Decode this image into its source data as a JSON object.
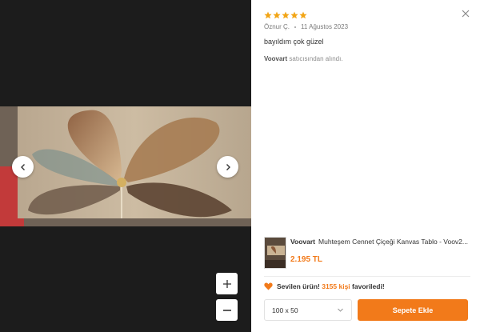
{
  "review": {
    "rating": 5,
    "author": "Öznur Ç.",
    "date": "11 Ağustos 2023",
    "comment": "bayıldım çok güzel",
    "seller_name": "Voovart",
    "seller_suffix": " satıcısından alındı."
  },
  "product": {
    "brand": "Voovart",
    "name": "Muhteşem Cennet Çiçeği Kanvas Tablo - Voov2...",
    "price": "2.195 TL"
  },
  "favorite": {
    "prefix": "Sevilen ürün! ",
    "count": "3155 kişi",
    "suffix": " favoriledi!"
  },
  "variant": {
    "selected": "100 x 50"
  },
  "actions": {
    "add_to_cart": "Sepete Ekle"
  },
  "icons": {
    "close": "close-icon",
    "prev": "chevron-left-icon",
    "next": "chevron-right-icon",
    "zoom_in": "plus-icon",
    "zoom_out": "minus-icon",
    "heart": "heart-icon",
    "dropdown": "chevron-down-icon",
    "star": "star-icon"
  },
  "colors": {
    "accent": "#f27a1a",
    "star": "#f2a516"
  }
}
